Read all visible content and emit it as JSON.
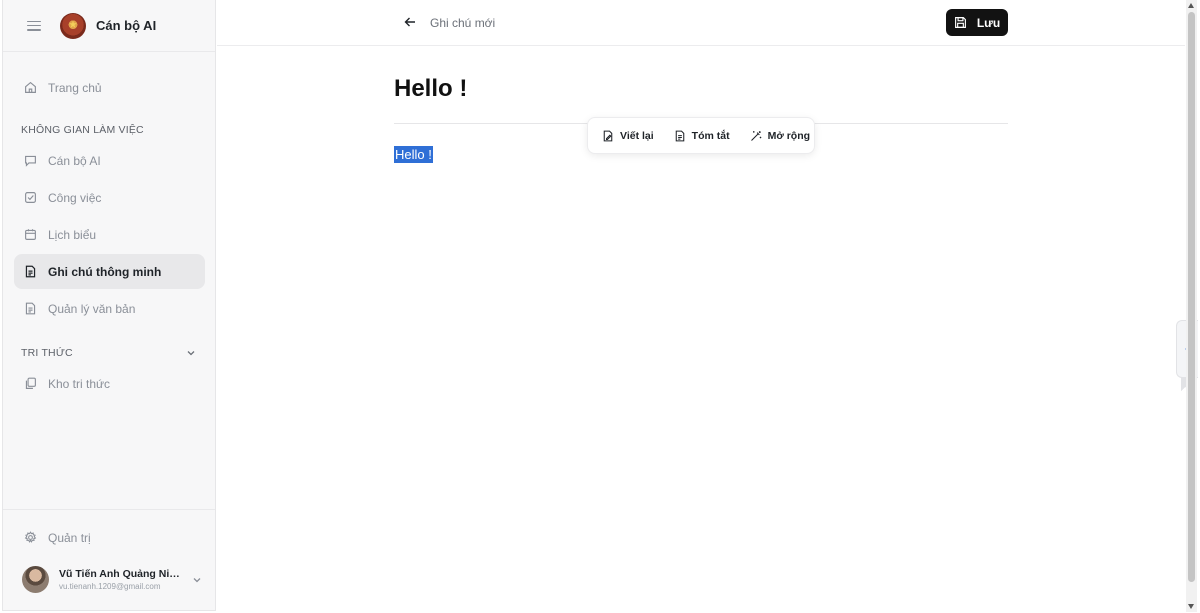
{
  "sidebar": {
    "brand": "Cán bộ AI",
    "home": "Trang chủ",
    "workspace_label": "KHÔNG GIAN LÀM VIỆC",
    "workspace_items": [
      {
        "label": "Cán bộ AI",
        "icon": "chat-icon"
      },
      {
        "label": "Công việc",
        "icon": "checkbox-icon"
      },
      {
        "label": "Lịch biểu",
        "icon": "calendar-icon"
      },
      {
        "label": "Ghi chú thông minh",
        "icon": "note-icon",
        "active": true
      },
      {
        "label": "Quản lý văn bản",
        "icon": "document-icon"
      }
    ],
    "knowledge_label": "TRI THỨC",
    "knowledge_items": [
      {
        "label": "Kho tri thức",
        "icon": "copy-icon"
      }
    ],
    "admin": "Quản trị",
    "user": {
      "name": "Vũ Tiến Anh Quảng Nin...",
      "email": "vu.tienanh.1209@gmail.com"
    }
  },
  "topbar": {
    "note_title": "Ghi chú mới",
    "save_label": "Lưu"
  },
  "editor": {
    "title": "Hello !",
    "body_selected": "Hello !"
  },
  "toolbar": {
    "rewrite": "Viết lại",
    "summarize": "Tóm tắt",
    "expand": "Mở rộng"
  },
  "colors": {
    "selection": "#2f6fd6",
    "save_button": "#121212",
    "active_nav": "#e8e8ea",
    "side_tab_chevron": "#2b6cd8"
  }
}
